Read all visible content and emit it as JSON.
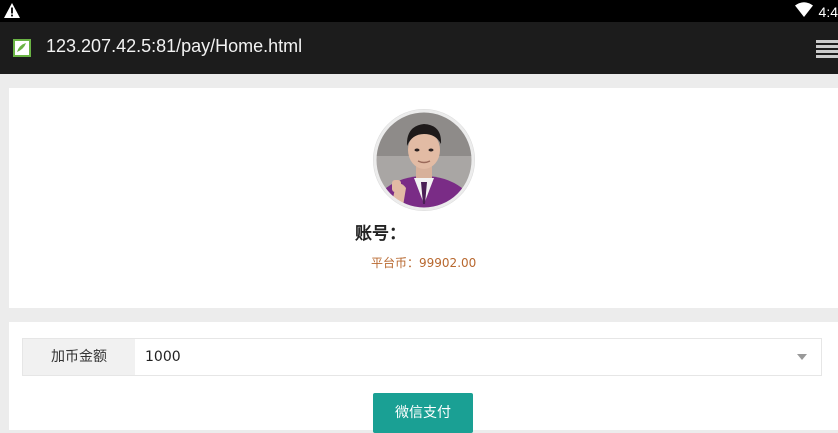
{
  "status_bar": {
    "time": "4:4"
  },
  "browser": {
    "url": "123.207.42.5:81/pay/Home.html"
  },
  "profile": {
    "account_label": "账号：",
    "account_value": "",
    "coin_label": "平台币：",
    "coin_value": "99902.00"
  },
  "payment": {
    "amount_label": "加币金额",
    "amount_value": "1000",
    "pay_button_label": "微信支付"
  },
  "colors": {
    "accent": "#1aa094",
    "coin_text": "#b8682f"
  }
}
